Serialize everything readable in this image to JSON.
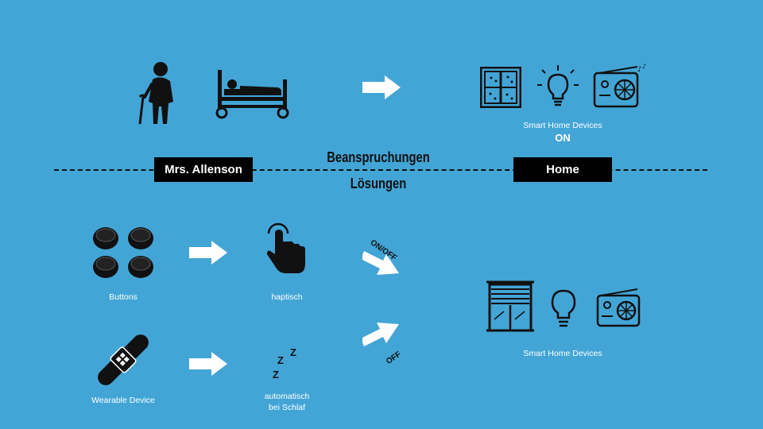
{
  "top_row": {
    "devices_caption": "Smart Home Devices",
    "devices_state": "ON"
  },
  "divider": {
    "left_label": "Mrs. Allenson",
    "right_label": "Home",
    "above_text": "Beanspruchungen",
    "below_text": "Lösungen"
  },
  "solutions": {
    "buttons_caption": "Buttons",
    "haptic_caption": "haptisch",
    "wearable_caption": "Wearable Device",
    "auto_caption_line1": "automatisch",
    "auto_caption_line2": "bei Schlaf",
    "sleep_z": [
      "Z",
      "Z",
      "Z"
    ],
    "arrow_up_tag": "ON/OFF",
    "arrow_down_tag": "OFF",
    "devices_caption": "Smart Home Devices"
  },
  "icons": {
    "elderly_woman": "elderly-woman-icon",
    "hospital_bed": "hospital-bed-icon",
    "window": "window-icon",
    "light_bulb": "light-bulb-icon",
    "radio": "radio-icon",
    "round_buttons": "round-buttons-icon",
    "tap_hand": "tap-hand-icon",
    "wearable_band": "wearable-band-icon",
    "window_blind": "window-blind-icon"
  },
  "colors": {
    "background": "#43a5d6",
    "arrow": "#ffffff",
    "label_box": "#000000",
    "dark": "#111111"
  }
}
